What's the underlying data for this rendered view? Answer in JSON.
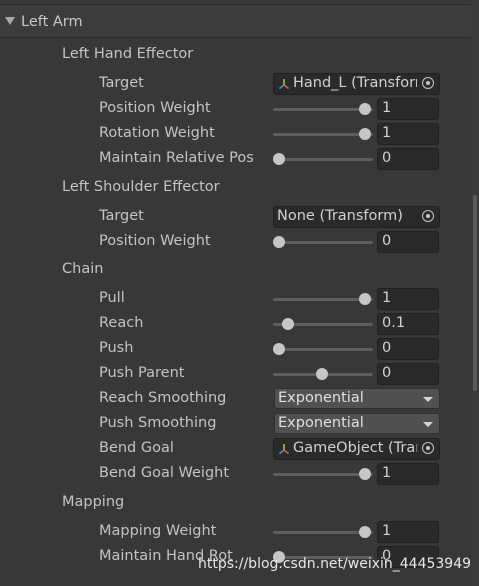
{
  "section": {
    "title": "Left Arm"
  },
  "hand_effector": {
    "header": "Left Hand Effector",
    "target_label": "Target",
    "target_value": "Hand_L (Transform)",
    "position_weight_label": "Position Weight",
    "position_weight": "1",
    "position_weight_level": 1.0,
    "rotation_weight_label": "Rotation Weight",
    "rotation_weight": "1",
    "rotation_weight_level": 1.0,
    "maintain_rel_label": "Maintain Relative Pos",
    "maintain_rel": "0",
    "maintain_rel_level": 0.0
  },
  "shoulder_effector": {
    "header": "Left Shoulder Effector",
    "target_label": "Target",
    "target_value": "None (Transform)",
    "position_weight_label": "Position Weight",
    "position_weight": "0",
    "position_weight_level": 0.0
  },
  "chain": {
    "header": "Chain",
    "pull_label": "Pull",
    "pull": "1",
    "pull_level": 1.0,
    "reach_label": "Reach",
    "reach": "0.1",
    "reach_level": 0.1,
    "push_label": "Push",
    "push": "0",
    "push_level": 0.0,
    "push_parent_label": "Push Parent",
    "push_parent": "0",
    "push_parent_level": 0.5,
    "reach_smoothing_label": "Reach Smoothing",
    "reach_smoothing": "Exponential",
    "push_smoothing_label": "Push Smoothing",
    "push_smoothing": "Exponential",
    "bend_goal_label": "Bend Goal",
    "bend_goal": "GameObject (Transform)",
    "bend_goal_weight_label": "Bend Goal Weight",
    "bend_goal_weight": "1",
    "bend_goal_weight_level": 1.0
  },
  "mapping": {
    "header": "Mapping",
    "mapping_weight_label": "Mapping Weight",
    "mapping_weight": "1",
    "mapping_weight_level": 1.0,
    "maintain_hand_rot_label": "Maintain Hand Rot",
    "maintain_hand_rot": "0",
    "maintain_hand_rot_level": 0.0
  },
  "watermark": "https://blog.csdn.net/weixin_44453949"
}
